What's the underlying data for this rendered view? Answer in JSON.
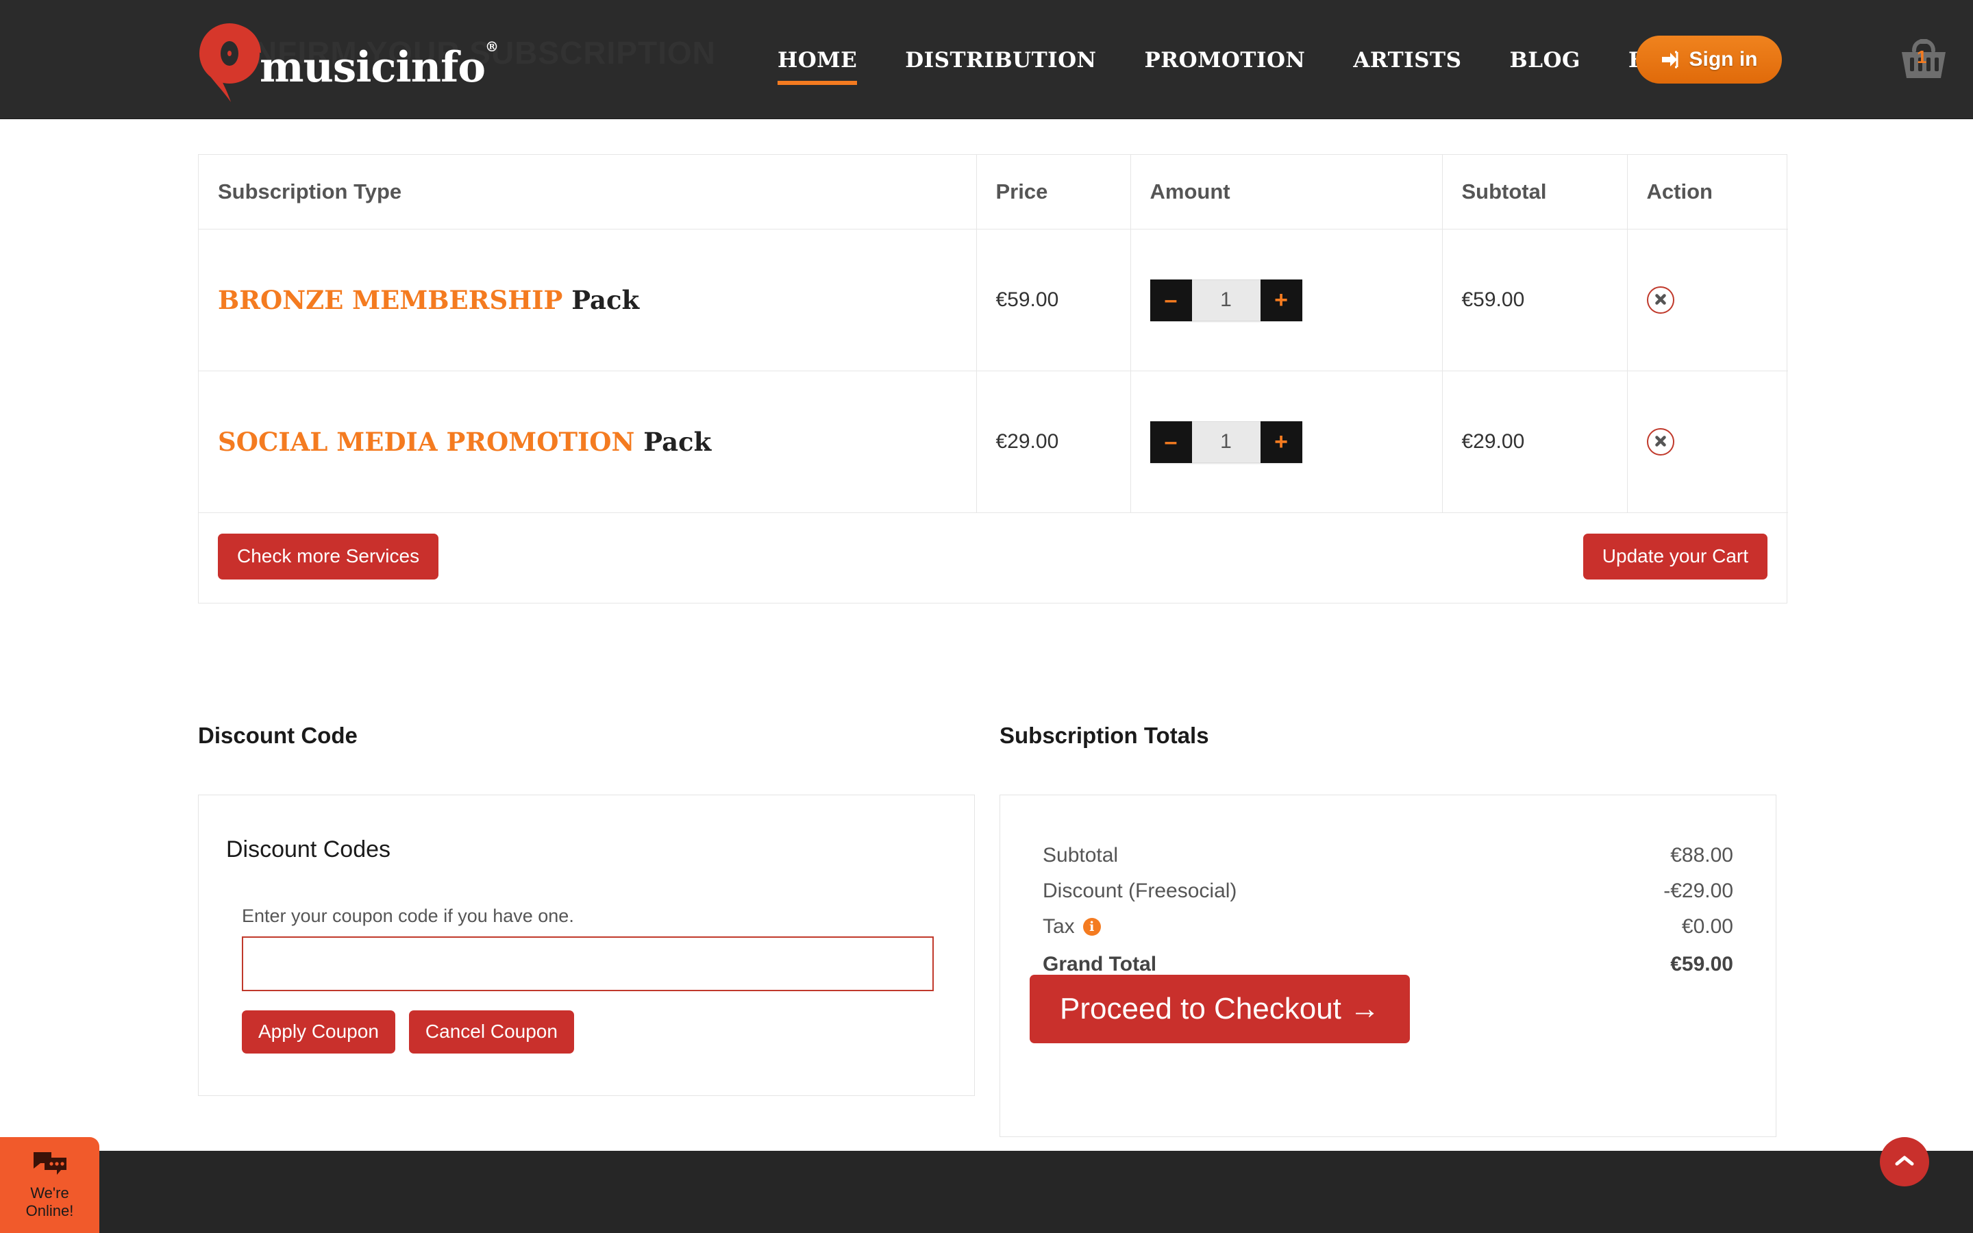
{
  "header": {
    "ghost_heading": "CONFIRM YOUR SUBSCRIPTION",
    "logo_text": "musicinfo",
    "logo_registered": "®",
    "nav": [
      {
        "label": "HOME",
        "active": true
      },
      {
        "label": "DISTRIBUTION",
        "active": false
      },
      {
        "label": "PROMOTION",
        "active": false
      },
      {
        "label": "ARTISTS",
        "active": false
      },
      {
        "label": "BLOG",
        "active": false
      },
      {
        "label": "HELP",
        "active": false
      }
    ],
    "signin_label": "Sign in",
    "cart_count": "1"
  },
  "cart": {
    "columns": {
      "type": "Subscription Type",
      "price": "Price",
      "amount": "Amount",
      "subtotal": "Subtotal",
      "action": "Action"
    },
    "rows": [
      {
        "name_highlight": "BRONZE MEMBERSHIP",
        "name_suffix": "Pack",
        "price": "€59.00",
        "qty": "1",
        "subtotal": "€59.00",
        "minus": "–",
        "plus": "+"
      },
      {
        "name_highlight": "SOCIAL MEDIA PROMOTION",
        "name_suffix": "Pack",
        "price": "€29.00",
        "qty": "1",
        "subtotal": "€29.00",
        "minus": "–",
        "plus": "+"
      }
    ],
    "check_more_label": "Check more Services",
    "update_cart_label": "Update your Cart"
  },
  "discount": {
    "section_title": "Discount Code",
    "card_heading": "Discount Codes",
    "hint": "Enter your coupon code if you have one.",
    "input_value": "",
    "input_placeholder": "",
    "apply_label": "Apply Coupon",
    "cancel_label": "Cancel Coupon"
  },
  "totals": {
    "section_title": "Subscription Totals",
    "rows": [
      {
        "label": "Subtotal",
        "value": "€88.00"
      },
      {
        "label": "Discount (Freesocial)",
        "value": "-€29.00"
      },
      {
        "label": "Tax",
        "value": "€0.00",
        "info": "i"
      },
      {
        "label": "Grand Total",
        "value": "€59.00"
      }
    ],
    "checkout_label": "Proceed to Checkout →"
  },
  "chat": {
    "line1": "We're",
    "line2": "Online!"
  },
  "colors": {
    "brand_orange": "#f47b20",
    "brand_red": "#c9302c",
    "header_dark": "#2b2b2b",
    "chat_orange": "#f15a2b"
  }
}
